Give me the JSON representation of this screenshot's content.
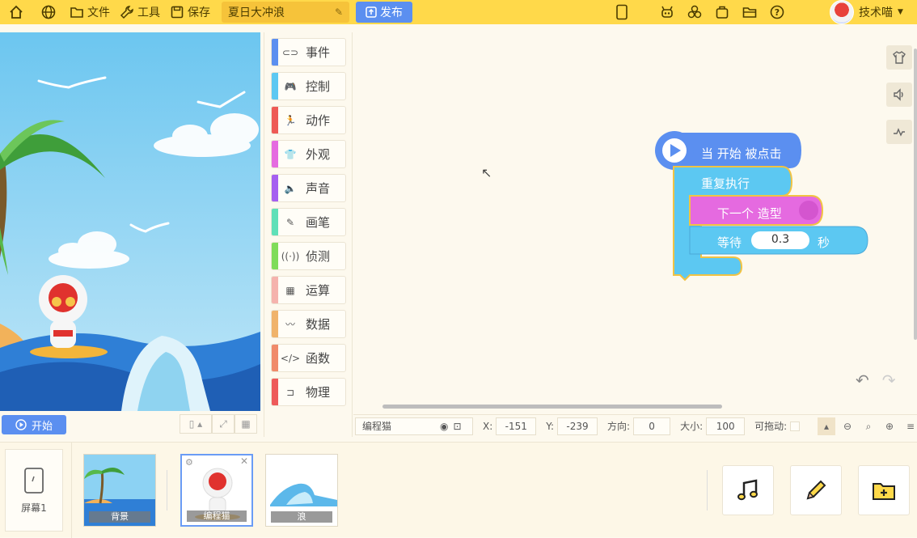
{
  "topbar": {
    "file_label": "文件",
    "tools_label": "工具",
    "save_label": "保存",
    "project_name": "夏日大冲浪",
    "publish_label": "发布",
    "username": "技术喵"
  },
  "stage": {
    "start_label": "开始"
  },
  "categories": [
    {
      "label": "事件",
      "color": "#5b8ff0",
      "icon": "toggle-icon"
    },
    {
      "label": "控制",
      "color": "#5cc8f2",
      "icon": "gamepad-icon"
    },
    {
      "label": "动作",
      "color": "#ee5a55",
      "icon": "running-icon"
    },
    {
      "label": "外观",
      "color": "#e56ae0",
      "icon": "shirt-icon"
    },
    {
      "label": "声音",
      "color": "#a55ff0",
      "icon": "speaker-icon"
    },
    {
      "label": "画笔",
      "color": "#5fe0b8",
      "icon": "pencil-icon"
    },
    {
      "label": "侦测",
      "color": "#7fdc5a",
      "icon": "signal-icon"
    },
    {
      "label": "运算",
      "color": "#f5b3ad",
      "icon": "calculator-icon"
    },
    {
      "label": "数据",
      "color": "#f0b36b",
      "icon": "chart-icon"
    },
    {
      "label": "函数",
      "color": "#f08a6a",
      "icon": "code-icon"
    },
    {
      "label": "物理",
      "color": "#ee5a5a",
      "icon": "magnet-icon"
    }
  ],
  "blocks": {
    "hat": "当 开始 被点击",
    "loop": "重复执行",
    "next_costume": "下一个 造型",
    "wait": "等待",
    "wait_value": "0.3",
    "wait_unit": "秒"
  },
  "sprite_info": {
    "name": "编程猫",
    "x_label": "X:",
    "x_value": "-151",
    "y_label": "Y:",
    "y_value": "-239",
    "direction_label": "方向:",
    "direction_value": "0",
    "size_label": "大小:",
    "size_value": "100",
    "draggable_label": "可拖动:"
  },
  "tray": {
    "screen_label": "屏幕1",
    "sprites": [
      "背景",
      "编程猫",
      "浪"
    ]
  }
}
